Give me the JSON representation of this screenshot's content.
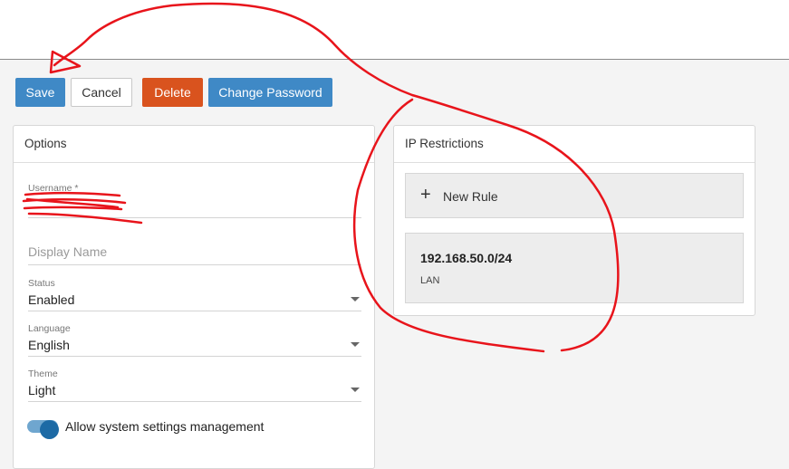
{
  "toolbar": {
    "save_label": "Save",
    "cancel_label": "Cancel",
    "delete_label": "Delete",
    "change_password_label": "Change Password"
  },
  "options": {
    "title": "Options",
    "username": {
      "label": "Username *",
      "value": ""
    },
    "display_name": {
      "placeholder": "Display Name",
      "value": ""
    },
    "status": {
      "label": "Status",
      "value": "Enabled"
    },
    "language": {
      "label": "Language",
      "value": "English"
    },
    "theme": {
      "label": "Theme",
      "value": "Light"
    },
    "allow_system_settings": {
      "label": "Allow system settings management",
      "enabled": true
    }
  },
  "ip_restrictions": {
    "title": "IP Restrictions",
    "new_rule_label": "New Rule",
    "rules": [
      {
        "address": "192.168.50.0/24",
        "description": "LAN"
      }
    ]
  },
  "colors": {
    "primary": "#3f89c6",
    "danger": "#d9531e",
    "toggle": "#1d6aa5",
    "annotation": "#e8141b"
  },
  "icons": {
    "add": "plus-icon",
    "dropdown": "chevron-down-icon"
  }
}
